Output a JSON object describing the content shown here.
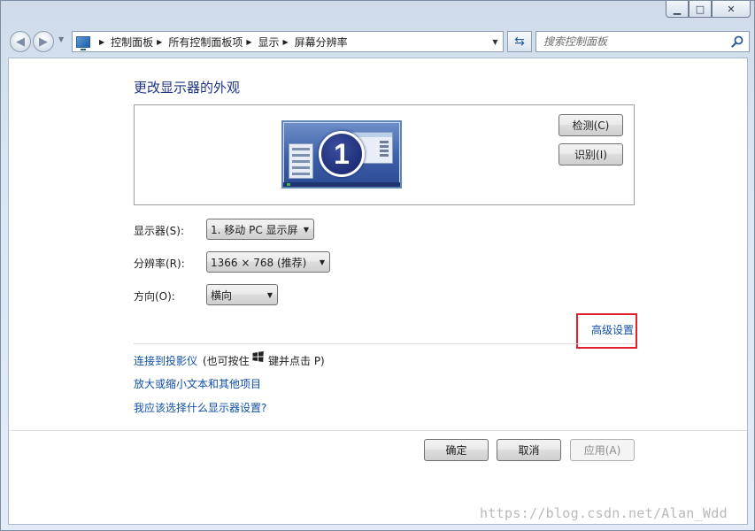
{
  "window": {
    "minimize_glyph": "▁",
    "maximize_glyph": "□",
    "close_glyph": "✕"
  },
  "nav": {
    "back_glyph": "◀",
    "forward_glyph": "▶",
    "dropdown_glyph": "▼",
    "breadcrumbs": [
      "控制面板",
      "所有控制面板项",
      "显示",
      "屏幕分辨率"
    ],
    "refresh_glyph": "⇆",
    "search_placeholder": "搜索控制面板"
  },
  "main": {
    "title": "更改显示器的外观",
    "monitor_number": "1",
    "detect_label": "检测(C)",
    "identify_label": "识别(I)",
    "display_label": "显示器(S):",
    "display_value": "1. 移动 PC 显示屏",
    "resolution_label": "分辨率(R):",
    "resolution_value": "1366 × 768 (推荐)",
    "orientation_label": "方向(O):",
    "orientation_value": "横向",
    "advanced_link": "高级设置",
    "projector_link": "连接到投影仪",
    "projector_note_pre": "(也可按住",
    "projector_note_post": "键并点击 P)",
    "text_size_link": "放大或缩小文本和其他项目",
    "which_settings_link": "我应该选择什么显示器设置?"
  },
  "footer": {
    "ok_label": "确定",
    "cancel_label": "取消",
    "apply_label": "应用(A)"
  },
  "watermark": "https://blog.csdn.net/Alan_Wdd",
  "colors": {
    "link": "#0f4fa8",
    "title": "#1e3287",
    "highlight_box": "#e3202a"
  }
}
